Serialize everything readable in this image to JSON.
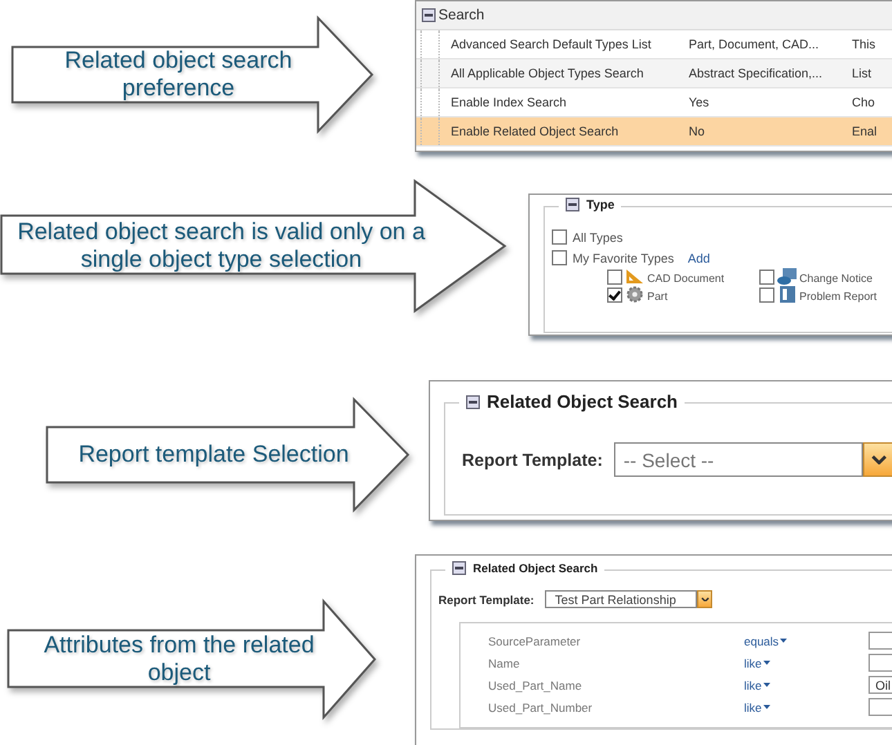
{
  "callouts": [
    {
      "text": "Related object search preference"
    },
    {
      "text": "Related object search is valid only on a single object type selection"
    },
    {
      "text": "Report template Selection"
    },
    {
      "text": "Attributes from the related object"
    }
  ],
  "preferences": {
    "group": "Search",
    "rows": [
      {
        "name": "Advanced Search Default Types List",
        "value": "Part, Document, CAD...",
        "description": "This",
        "selected": false
      },
      {
        "name": "All Applicable Object Types Search",
        "value": "Abstract Specification,...",
        "description": "List",
        "selected": false
      },
      {
        "name": "Enable Index Search",
        "value": "Yes",
        "description": "Cho",
        "selected": false
      },
      {
        "name": "Enable Related Object Search",
        "value": "No",
        "description": "Enal",
        "selected": true
      }
    ]
  },
  "type_picker": {
    "legend": "Type",
    "options": [
      {
        "label": "All Types",
        "checked": false
      },
      {
        "label": "My Favorite Types",
        "checked": false
      }
    ],
    "add_link": "Add",
    "types": [
      {
        "label": "CAD Document",
        "kind": "cad",
        "checked": false
      },
      {
        "label": "Change Notice",
        "kind": "notice",
        "checked": false
      },
      {
        "label": "Part",
        "kind": "part",
        "checked": true
      },
      {
        "label": "Problem Report",
        "kind": "report",
        "checked": false
      }
    ]
  },
  "template_panel": {
    "legend": "Related Object Search",
    "label": "Report Template:",
    "placeholder": "-- Select --"
  },
  "criteria_panel": {
    "legend": "Related Object Search",
    "label": "Report Template:",
    "template": "Test Part Relationship",
    "rows": [
      {
        "attribute": "SourceParameter",
        "operator": "equals",
        "value": ""
      },
      {
        "attribute": "Name",
        "operator": "like",
        "value": ""
      },
      {
        "attribute": "Used_Part_Name",
        "operator": "like",
        "value": "Oil"
      },
      {
        "attribute": "Used_Part_Number",
        "operator": "like",
        "value": ""
      }
    ]
  }
}
